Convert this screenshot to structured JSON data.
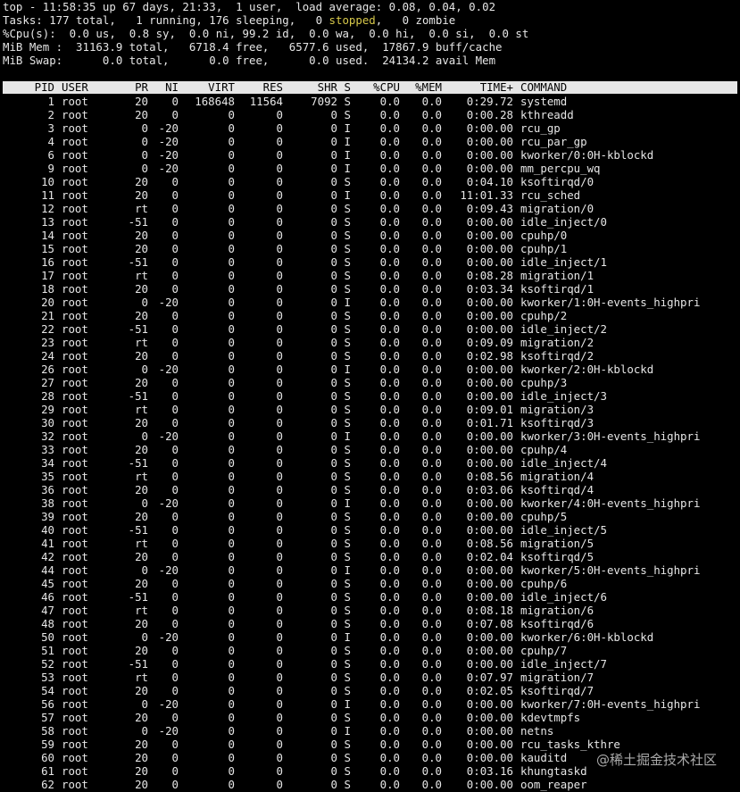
{
  "summary": {
    "line1": "top - 11:58:35 up 67 days, 21:33,  1 user,  load average: 0.08, 0.04, 0.02",
    "tasks_prefix": "Tasks: 177 total,   1 running, 176 sleeping,   0 ",
    "tasks_stopped": "stopped",
    "tasks_suffix": ",   0 zombie",
    "cpu": "%Cpu(s):  0.0 us,  0.8 sy,  0.0 ni, 99.2 id,  0.0 wa,  0.0 hi,  0.0 si,  0.0 st",
    "mem": "MiB Mem :  31163.9 total,   6718.4 free,   6577.6 used,  17867.9 buff/cache",
    "swap": "MiB Swap:      0.0 total,      0.0 free,      0.0 used.  24134.2 avail Mem"
  },
  "columns": {
    "pid": "PID",
    "user": "USER",
    "pr": "PR",
    "ni": "NI",
    "virt": "VIRT",
    "res": "RES",
    "shr": "SHR",
    "s": "S",
    "cpu": "%CPU",
    "mem": "%MEM",
    "time": "TIME+",
    "command": "COMMAND"
  },
  "processes": [
    [
      "1",
      "root",
      "20",
      "0",
      "168648",
      "11564",
      "7092",
      "S",
      "0.0",
      "0.0",
      "0:29.72",
      "systemd"
    ],
    [
      "2",
      "root",
      "20",
      "0",
      "0",
      "0",
      "0",
      "S",
      "0.0",
      "0.0",
      "0:00.28",
      "kthreadd"
    ],
    [
      "3",
      "root",
      "0",
      "-20",
      "0",
      "0",
      "0",
      "I",
      "0.0",
      "0.0",
      "0:00.00",
      "rcu_gp"
    ],
    [
      "4",
      "root",
      "0",
      "-20",
      "0",
      "0",
      "0",
      "I",
      "0.0",
      "0.0",
      "0:00.00",
      "rcu_par_gp"
    ],
    [
      "6",
      "root",
      "0",
      "-20",
      "0",
      "0",
      "0",
      "I",
      "0.0",
      "0.0",
      "0:00.00",
      "kworker/0:0H-kblockd"
    ],
    [
      "9",
      "root",
      "0",
      "-20",
      "0",
      "0",
      "0",
      "I",
      "0.0",
      "0.0",
      "0:00.00",
      "mm_percpu_wq"
    ],
    [
      "10",
      "root",
      "20",
      "0",
      "0",
      "0",
      "0",
      "S",
      "0.0",
      "0.0",
      "0:04.10",
      "ksoftirqd/0"
    ],
    [
      "11",
      "root",
      "20",
      "0",
      "0",
      "0",
      "0",
      "I",
      "0.0",
      "0.0",
      "11:01.33",
      "rcu_sched"
    ],
    [
      "12",
      "root",
      "rt",
      "0",
      "0",
      "0",
      "0",
      "S",
      "0.0",
      "0.0",
      "0:09.43",
      "migration/0"
    ],
    [
      "13",
      "root",
      "-51",
      "0",
      "0",
      "0",
      "0",
      "S",
      "0.0",
      "0.0",
      "0:00.00",
      "idle_inject/0"
    ],
    [
      "14",
      "root",
      "20",
      "0",
      "0",
      "0",
      "0",
      "S",
      "0.0",
      "0.0",
      "0:00.00",
      "cpuhp/0"
    ],
    [
      "15",
      "root",
      "20",
      "0",
      "0",
      "0",
      "0",
      "S",
      "0.0",
      "0.0",
      "0:00.00",
      "cpuhp/1"
    ],
    [
      "16",
      "root",
      "-51",
      "0",
      "0",
      "0",
      "0",
      "S",
      "0.0",
      "0.0",
      "0:00.00",
      "idle_inject/1"
    ],
    [
      "17",
      "root",
      "rt",
      "0",
      "0",
      "0",
      "0",
      "S",
      "0.0",
      "0.0",
      "0:08.28",
      "migration/1"
    ],
    [
      "18",
      "root",
      "20",
      "0",
      "0",
      "0",
      "0",
      "S",
      "0.0",
      "0.0",
      "0:03.34",
      "ksoftirqd/1"
    ],
    [
      "20",
      "root",
      "0",
      "-20",
      "0",
      "0",
      "0",
      "I",
      "0.0",
      "0.0",
      "0:00.00",
      "kworker/1:0H-events_highpri"
    ],
    [
      "21",
      "root",
      "20",
      "0",
      "0",
      "0",
      "0",
      "S",
      "0.0",
      "0.0",
      "0:00.00",
      "cpuhp/2"
    ],
    [
      "22",
      "root",
      "-51",
      "0",
      "0",
      "0",
      "0",
      "S",
      "0.0",
      "0.0",
      "0:00.00",
      "idle_inject/2"
    ],
    [
      "23",
      "root",
      "rt",
      "0",
      "0",
      "0",
      "0",
      "S",
      "0.0",
      "0.0",
      "0:09.09",
      "migration/2"
    ],
    [
      "24",
      "root",
      "20",
      "0",
      "0",
      "0",
      "0",
      "S",
      "0.0",
      "0.0",
      "0:02.98",
      "ksoftirqd/2"
    ],
    [
      "26",
      "root",
      "0",
      "-20",
      "0",
      "0",
      "0",
      "I",
      "0.0",
      "0.0",
      "0:00.00",
      "kworker/2:0H-kblockd"
    ],
    [
      "27",
      "root",
      "20",
      "0",
      "0",
      "0",
      "0",
      "S",
      "0.0",
      "0.0",
      "0:00.00",
      "cpuhp/3"
    ],
    [
      "28",
      "root",
      "-51",
      "0",
      "0",
      "0",
      "0",
      "S",
      "0.0",
      "0.0",
      "0:00.00",
      "idle_inject/3"
    ],
    [
      "29",
      "root",
      "rt",
      "0",
      "0",
      "0",
      "0",
      "S",
      "0.0",
      "0.0",
      "0:09.01",
      "migration/3"
    ],
    [
      "30",
      "root",
      "20",
      "0",
      "0",
      "0",
      "0",
      "S",
      "0.0",
      "0.0",
      "0:01.71",
      "ksoftirqd/3"
    ],
    [
      "32",
      "root",
      "0",
      "-20",
      "0",
      "0",
      "0",
      "I",
      "0.0",
      "0.0",
      "0:00.00",
      "kworker/3:0H-events_highpri"
    ],
    [
      "33",
      "root",
      "20",
      "0",
      "0",
      "0",
      "0",
      "S",
      "0.0",
      "0.0",
      "0:00.00",
      "cpuhp/4"
    ],
    [
      "34",
      "root",
      "-51",
      "0",
      "0",
      "0",
      "0",
      "S",
      "0.0",
      "0.0",
      "0:00.00",
      "idle_inject/4"
    ],
    [
      "35",
      "root",
      "rt",
      "0",
      "0",
      "0",
      "0",
      "S",
      "0.0",
      "0.0",
      "0:08.56",
      "migration/4"
    ],
    [
      "36",
      "root",
      "20",
      "0",
      "0",
      "0",
      "0",
      "S",
      "0.0",
      "0.0",
      "0:03.06",
      "ksoftirqd/4"
    ],
    [
      "38",
      "root",
      "0",
      "-20",
      "0",
      "0",
      "0",
      "I",
      "0.0",
      "0.0",
      "0:00.00",
      "kworker/4:0H-events_highpri"
    ],
    [
      "39",
      "root",
      "20",
      "0",
      "0",
      "0",
      "0",
      "S",
      "0.0",
      "0.0",
      "0:00.00",
      "cpuhp/5"
    ],
    [
      "40",
      "root",
      "-51",
      "0",
      "0",
      "0",
      "0",
      "S",
      "0.0",
      "0.0",
      "0:00.00",
      "idle_inject/5"
    ],
    [
      "41",
      "root",
      "rt",
      "0",
      "0",
      "0",
      "0",
      "S",
      "0.0",
      "0.0",
      "0:08.56",
      "migration/5"
    ],
    [
      "42",
      "root",
      "20",
      "0",
      "0",
      "0",
      "0",
      "S",
      "0.0",
      "0.0",
      "0:02.04",
      "ksoftirqd/5"
    ],
    [
      "44",
      "root",
      "0",
      "-20",
      "0",
      "0",
      "0",
      "I",
      "0.0",
      "0.0",
      "0:00.00",
      "kworker/5:0H-events_highpri"
    ],
    [
      "45",
      "root",
      "20",
      "0",
      "0",
      "0",
      "0",
      "S",
      "0.0",
      "0.0",
      "0:00.00",
      "cpuhp/6"
    ],
    [
      "46",
      "root",
      "-51",
      "0",
      "0",
      "0",
      "0",
      "S",
      "0.0",
      "0.0",
      "0:00.00",
      "idle_inject/6"
    ],
    [
      "47",
      "root",
      "rt",
      "0",
      "0",
      "0",
      "0",
      "S",
      "0.0",
      "0.0",
      "0:08.18",
      "migration/6"
    ],
    [
      "48",
      "root",
      "20",
      "0",
      "0",
      "0",
      "0",
      "S",
      "0.0",
      "0.0",
      "0:07.08",
      "ksoftirqd/6"
    ],
    [
      "50",
      "root",
      "0",
      "-20",
      "0",
      "0",
      "0",
      "I",
      "0.0",
      "0.0",
      "0:00.00",
      "kworker/6:0H-kblockd"
    ],
    [
      "51",
      "root",
      "20",
      "0",
      "0",
      "0",
      "0",
      "S",
      "0.0",
      "0.0",
      "0:00.00",
      "cpuhp/7"
    ],
    [
      "52",
      "root",
      "-51",
      "0",
      "0",
      "0",
      "0",
      "S",
      "0.0",
      "0.0",
      "0:00.00",
      "idle_inject/7"
    ],
    [
      "53",
      "root",
      "rt",
      "0",
      "0",
      "0",
      "0",
      "S",
      "0.0",
      "0.0",
      "0:07.97",
      "migration/7"
    ],
    [
      "54",
      "root",
      "20",
      "0",
      "0",
      "0",
      "0",
      "S",
      "0.0",
      "0.0",
      "0:02.05",
      "ksoftirqd/7"
    ],
    [
      "56",
      "root",
      "0",
      "-20",
      "0",
      "0",
      "0",
      "I",
      "0.0",
      "0.0",
      "0:00.00",
      "kworker/7:0H-events_highpri"
    ],
    [
      "57",
      "root",
      "20",
      "0",
      "0",
      "0",
      "0",
      "S",
      "0.0",
      "0.0",
      "0:00.00",
      "kdevtmpfs"
    ],
    [
      "58",
      "root",
      "0",
      "-20",
      "0",
      "0",
      "0",
      "I",
      "0.0",
      "0.0",
      "0:00.00",
      "netns"
    ],
    [
      "59",
      "root",
      "20",
      "0",
      "0",
      "0",
      "0",
      "S",
      "0.0",
      "0.0",
      "0:00.00",
      "rcu_tasks_kthre"
    ],
    [
      "60",
      "root",
      "20",
      "0",
      "0",
      "0",
      "0",
      "S",
      "0.0",
      "0.0",
      "0:00.00",
      "kauditd"
    ],
    [
      "61",
      "root",
      "20",
      "0",
      "0",
      "0",
      "0",
      "S",
      "0.0",
      "0.0",
      "0:03.16",
      "khungtaskd"
    ],
    [
      "62",
      "root",
      "20",
      "0",
      "0",
      "0",
      "0",
      "S",
      "0.0",
      "0.0",
      "0:00.00",
      "oom_reaper"
    ]
  ],
  "watermark": "@稀土掘金技术社区",
  "colors": {
    "background": "#000000",
    "foreground": "#e6e6e6",
    "header_background": "#e6e6e6",
    "header_foreground": "#000000",
    "stopped": "#d7c84a"
  }
}
